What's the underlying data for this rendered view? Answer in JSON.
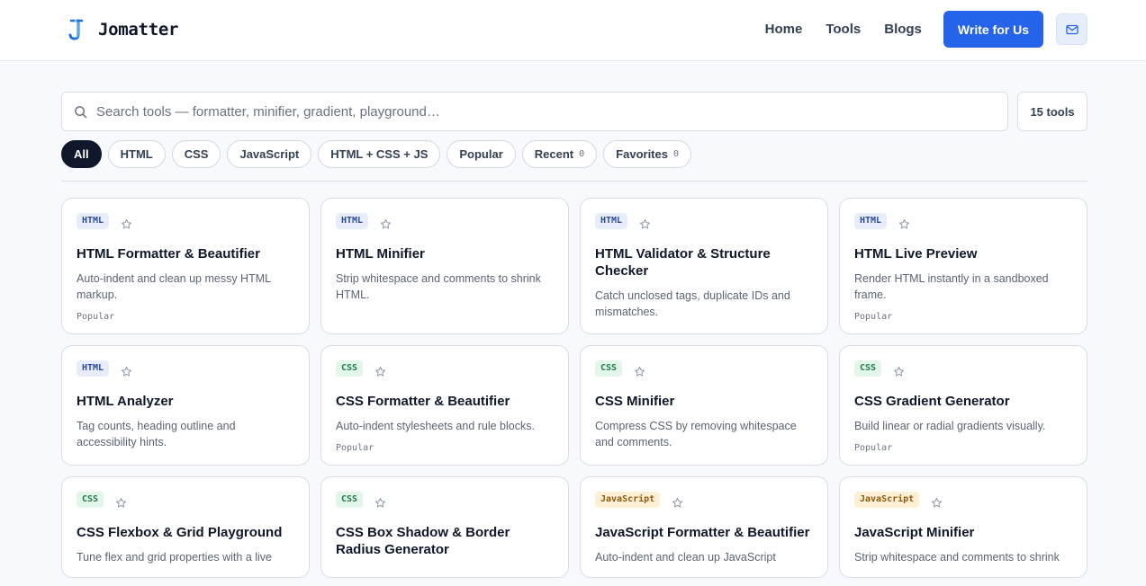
{
  "brand": {
    "name": "Jomatter",
    "accent": "#2563eb",
    "logo_icon": "j-letter-icon"
  },
  "nav": {
    "items": [
      "Home",
      "Tools",
      "Blogs"
    ],
    "cta": "Write for Us",
    "mail_icon": "mail-icon"
  },
  "search": {
    "placeholder": "Search tools — formatter, minifier, gradient, playground…",
    "value": "",
    "count_label": "15 tools"
  },
  "filters": [
    {
      "label": "All",
      "active": true
    },
    {
      "label": "HTML"
    },
    {
      "label": "CSS"
    },
    {
      "label": "JavaScript"
    },
    {
      "label": "HTML + CSS + JS"
    },
    {
      "label": "Popular"
    },
    {
      "label": "Recent",
      "count": "0"
    },
    {
      "label": "Favorites",
      "count": "0"
    }
  ],
  "tools": [
    {
      "tag": "HTML",
      "kind": "html",
      "title": "HTML Formatter & Beautifier",
      "desc": "Auto-indent and clean up messy HTML markup.",
      "badge": "Popular"
    },
    {
      "tag": "HTML",
      "kind": "html",
      "title": "HTML Minifier",
      "desc": "Strip whitespace and comments to shrink HTML.",
      "badge": ""
    },
    {
      "tag": "HTML",
      "kind": "html",
      "title": "HTML Validator & Structure Checker",
      "desc": "Catch unclosed tags, duplicate IDs and mismatches.",
      "badge": ""
    },
    {
      "tag": "HTML",
      "kind": "html",
      "title": "HTML Live Preview",
      "desc": "Render HTML instantly in a sandboxed frame.",
      "badge": "Popular"
    },
    {
      "tag": "HTML",
      "kind": "html",
      "title": "HTML Analyzer",
      "desc": "Tag counts, heading outline and accessibility hints.",
      "badge": ""
    },
    {
      "tag": "CSS",
      "kind": "css",
      "title": "CSS Formatter & Beautifier",
      "desc": "Auto-indent stylesheets and rule blocks.",
      "badge": "Popular"
    },
    {
      "tag": "CSS",
      "kind": "css",
      "title": "CSS Minifier",
      "desc": "Compress CSS by removing whitespace and comments.",
      "badge": ""
    },
    {
      "tag": "CSS",
      "kind": "css",
      "title": "CSS Gradient Generator",
      "desc": "Build linear or radial gradients visually.",
      "badge": "Popular"
    },
    {
      "tag": "CSS",
      "kind": "css",
      "title": "CSS Flexbox & Grid Playground",
      "desc": "Tune flex and grid properties with a live",
      "badge": ""
    },
    {
      "tag": "CSS",
      "kind": "css",
      "title": "CSS Box Shadow & Border Radius Generator",
      "desc": "",
      "badge": ""
    },
    {
      "tag": "JavaScript",
      "kind": "js",
      "title": "JavaScript Formatter & Beautifier",
      "desc": "Auto-indent and clean up JavaScript",
      "badge": ""
    },
    {
      "tag": "JavaScript",
      "kind": "js",
      "title": "JavaScript Minifier",
      "desc": "Strip whitespace and comments to shrink",
      "badge": ""
    }
  ]
}
